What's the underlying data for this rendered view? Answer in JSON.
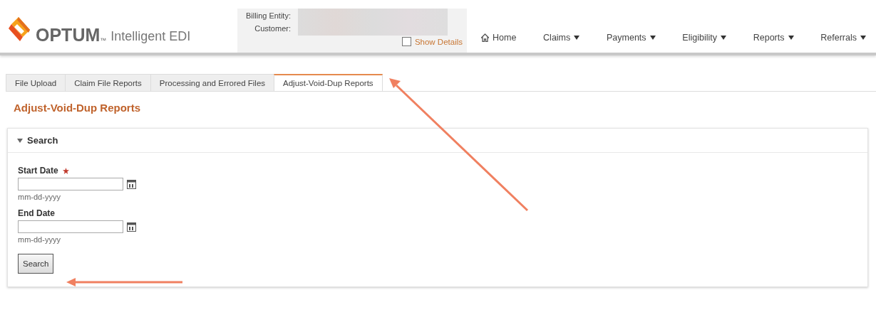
{
  "header": {
    "brand": "OPTUM",
    "trademark": "™",
    "product": "Intelligent EDI"
  },
  "account": {
    "billing_label": "Billing Entity:",
    "customer_label": "Customer:",
    "show_details": {
      "label": "Show Details",
      "checked": false
    }
  },
  "nav": [
    {
      "label": "Home",
      "kind": "home"
    },
    {
      "label": "Claims",
      "kind": "menu"
    },
    {
      "label": "Payments",
      "kind": "menu"
    },
    {
      "label": "Eligibility",
      "kind": "menu"
    },
    {
      "label": "Reports",
      "kind": "menu"
    },
    {
      "label": "Referrals",
      "kind": "menu"
    }
  ],
  "tabs": [
    {
      "label": "File Upload",
      "selected": false
    },
    {
      "label": "Claim File Reports",
      "selected": false
    },
    {
      "label": "Processing and Errored Files",
      "selected": false
    },
    {
      "label": "Adjust-Void-Dup Reports",
      "selected": true
    }
  ],
  "page_title": "Adjust-Void-Dup Reports",
  "search_panel": {
    "title": "Search",
    "expanded": true,
    "fields": [
      {
        "label": "Start Date",
        "required": true,
        "hint": "mm-dd-yyyy"
      },
      {
        "label": "End Date",
        "required": false,
        "hint": "mm-dd-yyyy"
      }
    ],
    "button": "Search"
  }
}
